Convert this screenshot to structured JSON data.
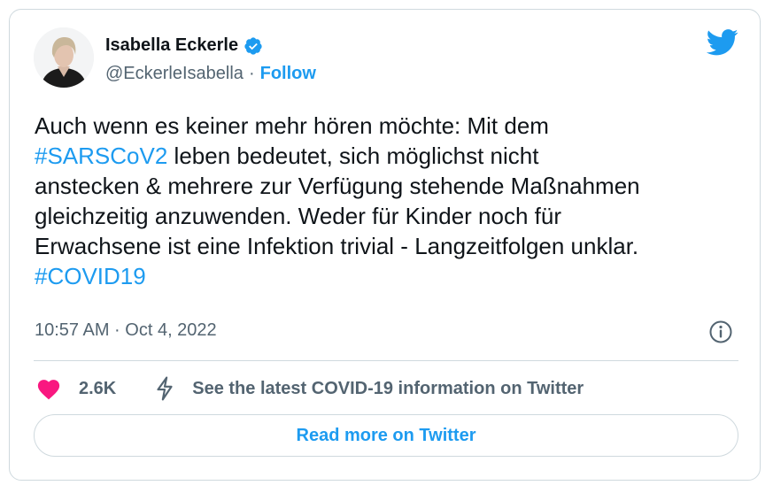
{
  "author": {
    "name": "Isabella Eckerle",
    "handle": "@EckerleIsabella",
    "follow_label": "Follow"
  },
  "tweet": {
    "segments": [
      {
        "text": "Auch wenn es keiner mehr hören möchte: Mit dem\n",
        "type": "text"
      },
      {
        "text": "#SARSCoV2",
        "type": "hashtag"
      },
      {
        "text": " leben bedeutet, sich möglichst nicht\nanstecken & mehrere zur Verfügung stehende Maßnahmen\ngleichzeitig anzuwenden. Weder für Kinder noch für\nErwachsene ist eine Infektion trivial - Langzeitfolgen unklar.\n",
        "type": "text"
      },
      {
        "text": "#COVID19",
        "type": "hashtag"
      }
    ],
    "timestamp": "10:57 AM · Oct 4, 2022"
  },
  "actions": {
    "like_count": "2.6K",
    "covid_info": "See the latest COVID-19 information on Twitter",
    "read_more": "Read more on Twitter"
  },
  "icons": {
    "verified": "verified-badge-icon",
    "twitter": "twitter-bird-icon",
    "info": "info-icon",
    "heart": "heart-icon",
    "bolt": "lightning-bolt-icon"
  },
  "colors": {
    "accent": "#1d9bf0",
    "heart": "#f91880",
    "secondary_text": "#536471",
    "border": "#cfd9de"
  }
}
